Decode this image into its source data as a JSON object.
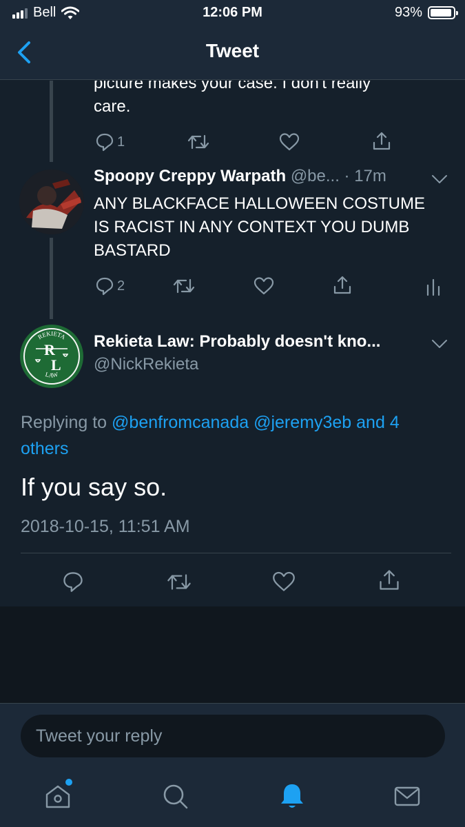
{
  "status_bar": {
    "carrier": "Bell",
    "time": "12:06 PM",
    "battery": "93%",
    "battery_level": 0.93
  },
  "nav": {
    "title": "Tweet"
  },
  "prev_tweet": {
    "text_partial_line": "picture makes your case.  I don't really",
    "text_last_line": "care.",
    "reply_count": "1"
  },
  "reply_tweet": {
    "name": "Spoopy Creppy Warpath",
    "handle": "@be...",
    "time": "· 17m",
    "text": "ANY BLACKFACE HALLOWEEN COSTUME IS RACIST IN ANY CONTEXT YOU DUMB BASTARD",
    "reply_count": "2"
  },
  "main_tweet": {
    "name": "Rekieta Law: Probably doesn't kno...",
    "handle": "@NickRekieta",
    "logo_text_top": "REKIETA",
    "logo_text_bottom": "LAW",
    "replying_prefix": "Replying to ",
    "replying_to": [
      "@benfromcanada",
      "@jeremy3eb"
    ],
    "replying_others": "and 4 others",
    "text": "If you say so.",
    "timestamp": "2018-10-15, 11:51 AM"
  },
  "reply_box": {
    "placeholder": "Tweet your reply"
  },
  "tab_bar": {
    "items": [
      "home-icon",
      "search-icon",
      "notifications-icon",
      "messages-icon"
    ],
    "active": "notifications-icon"
  },
  "colors": {
    "background": "#15202b",
    "accent": "#1da1f2",
    "muted": "#8899a6",
    "bar": "#1c2938"
  }
}
